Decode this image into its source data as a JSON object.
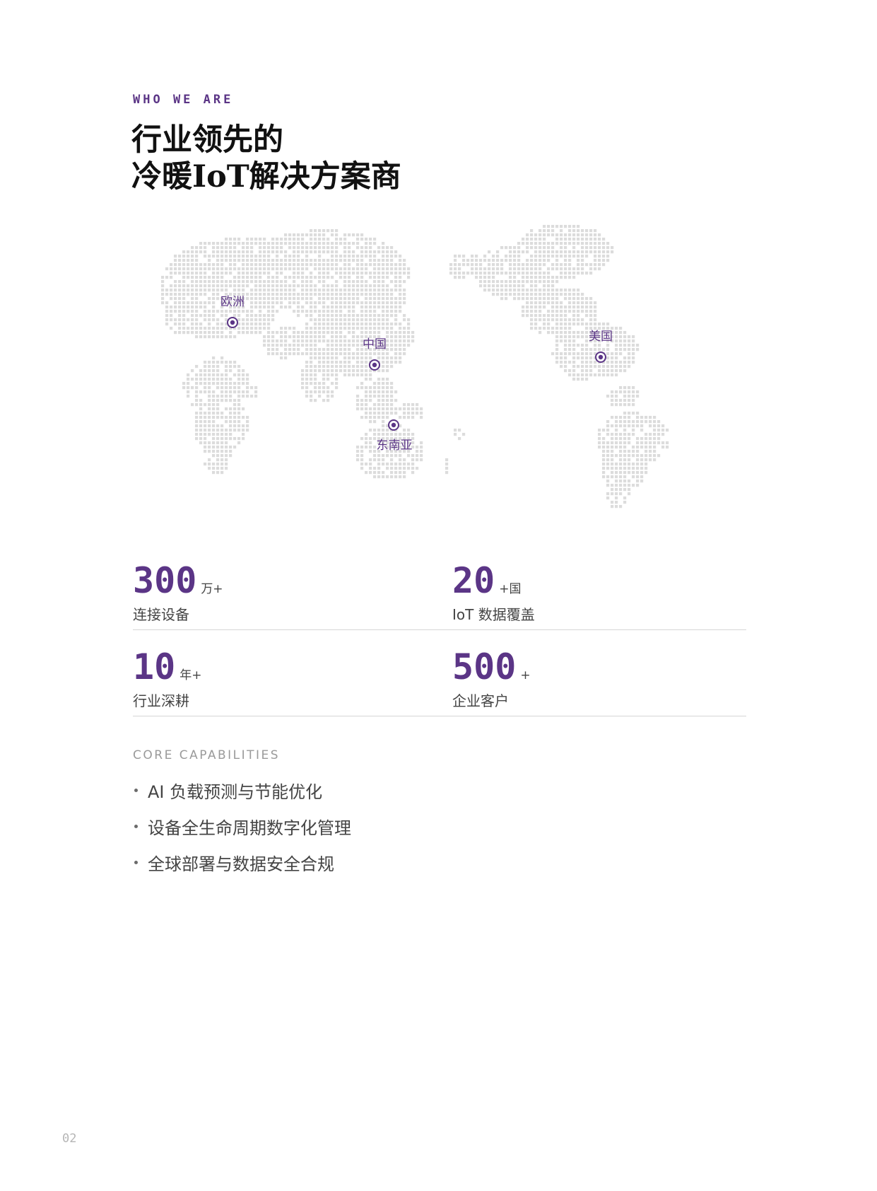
{
  "eyebrow": "WHO WE ARE",
  "title": {
    "line1": "行业领先的",
    "line2": "冷暖IoT解决方案商"
  },
  "map": {
    "dot_color": "#dcdcdc",
    "marker_color": "#5b3586",
    "markers": [
      {
        "id": "europe",
        "label": "欧洲"
      },
      {
        "id": "china",
        "label": "中国"
      },
      {
        "id": "usa",
        "label": "美国"
      },
      {
        "id": "sea",
        "label": "东南亚"
      }
    ]
  },
  "stats": [
    {
      "value": "300",
      "unit": "万+",
      "label": "连接设备"
    },
    {
      "value": "20",
      "unit": "+国",
      "label": "IoT 数据覆盖"
    },
    {
      "value": "10",
      "unit": "年+",
      "label": "行业深耕"
    },
    {
      "value": "500",
      "unit": "+",
      "label": "企业客户"
    }
  ],
  "capabilities": {
    "title": "CORE CAPABILITIES",
    "items": [
      "AI 负载预测与节能优化",
      "设备全生命周期数字化管理",
      "全球部署与数据安全合规"
    ]
  },
  "page_number": "02",
  "colors": {
    "accent": "#5b3586",
    "text": "#111111",
    "muted": "#9a9a9a"
  }
}
